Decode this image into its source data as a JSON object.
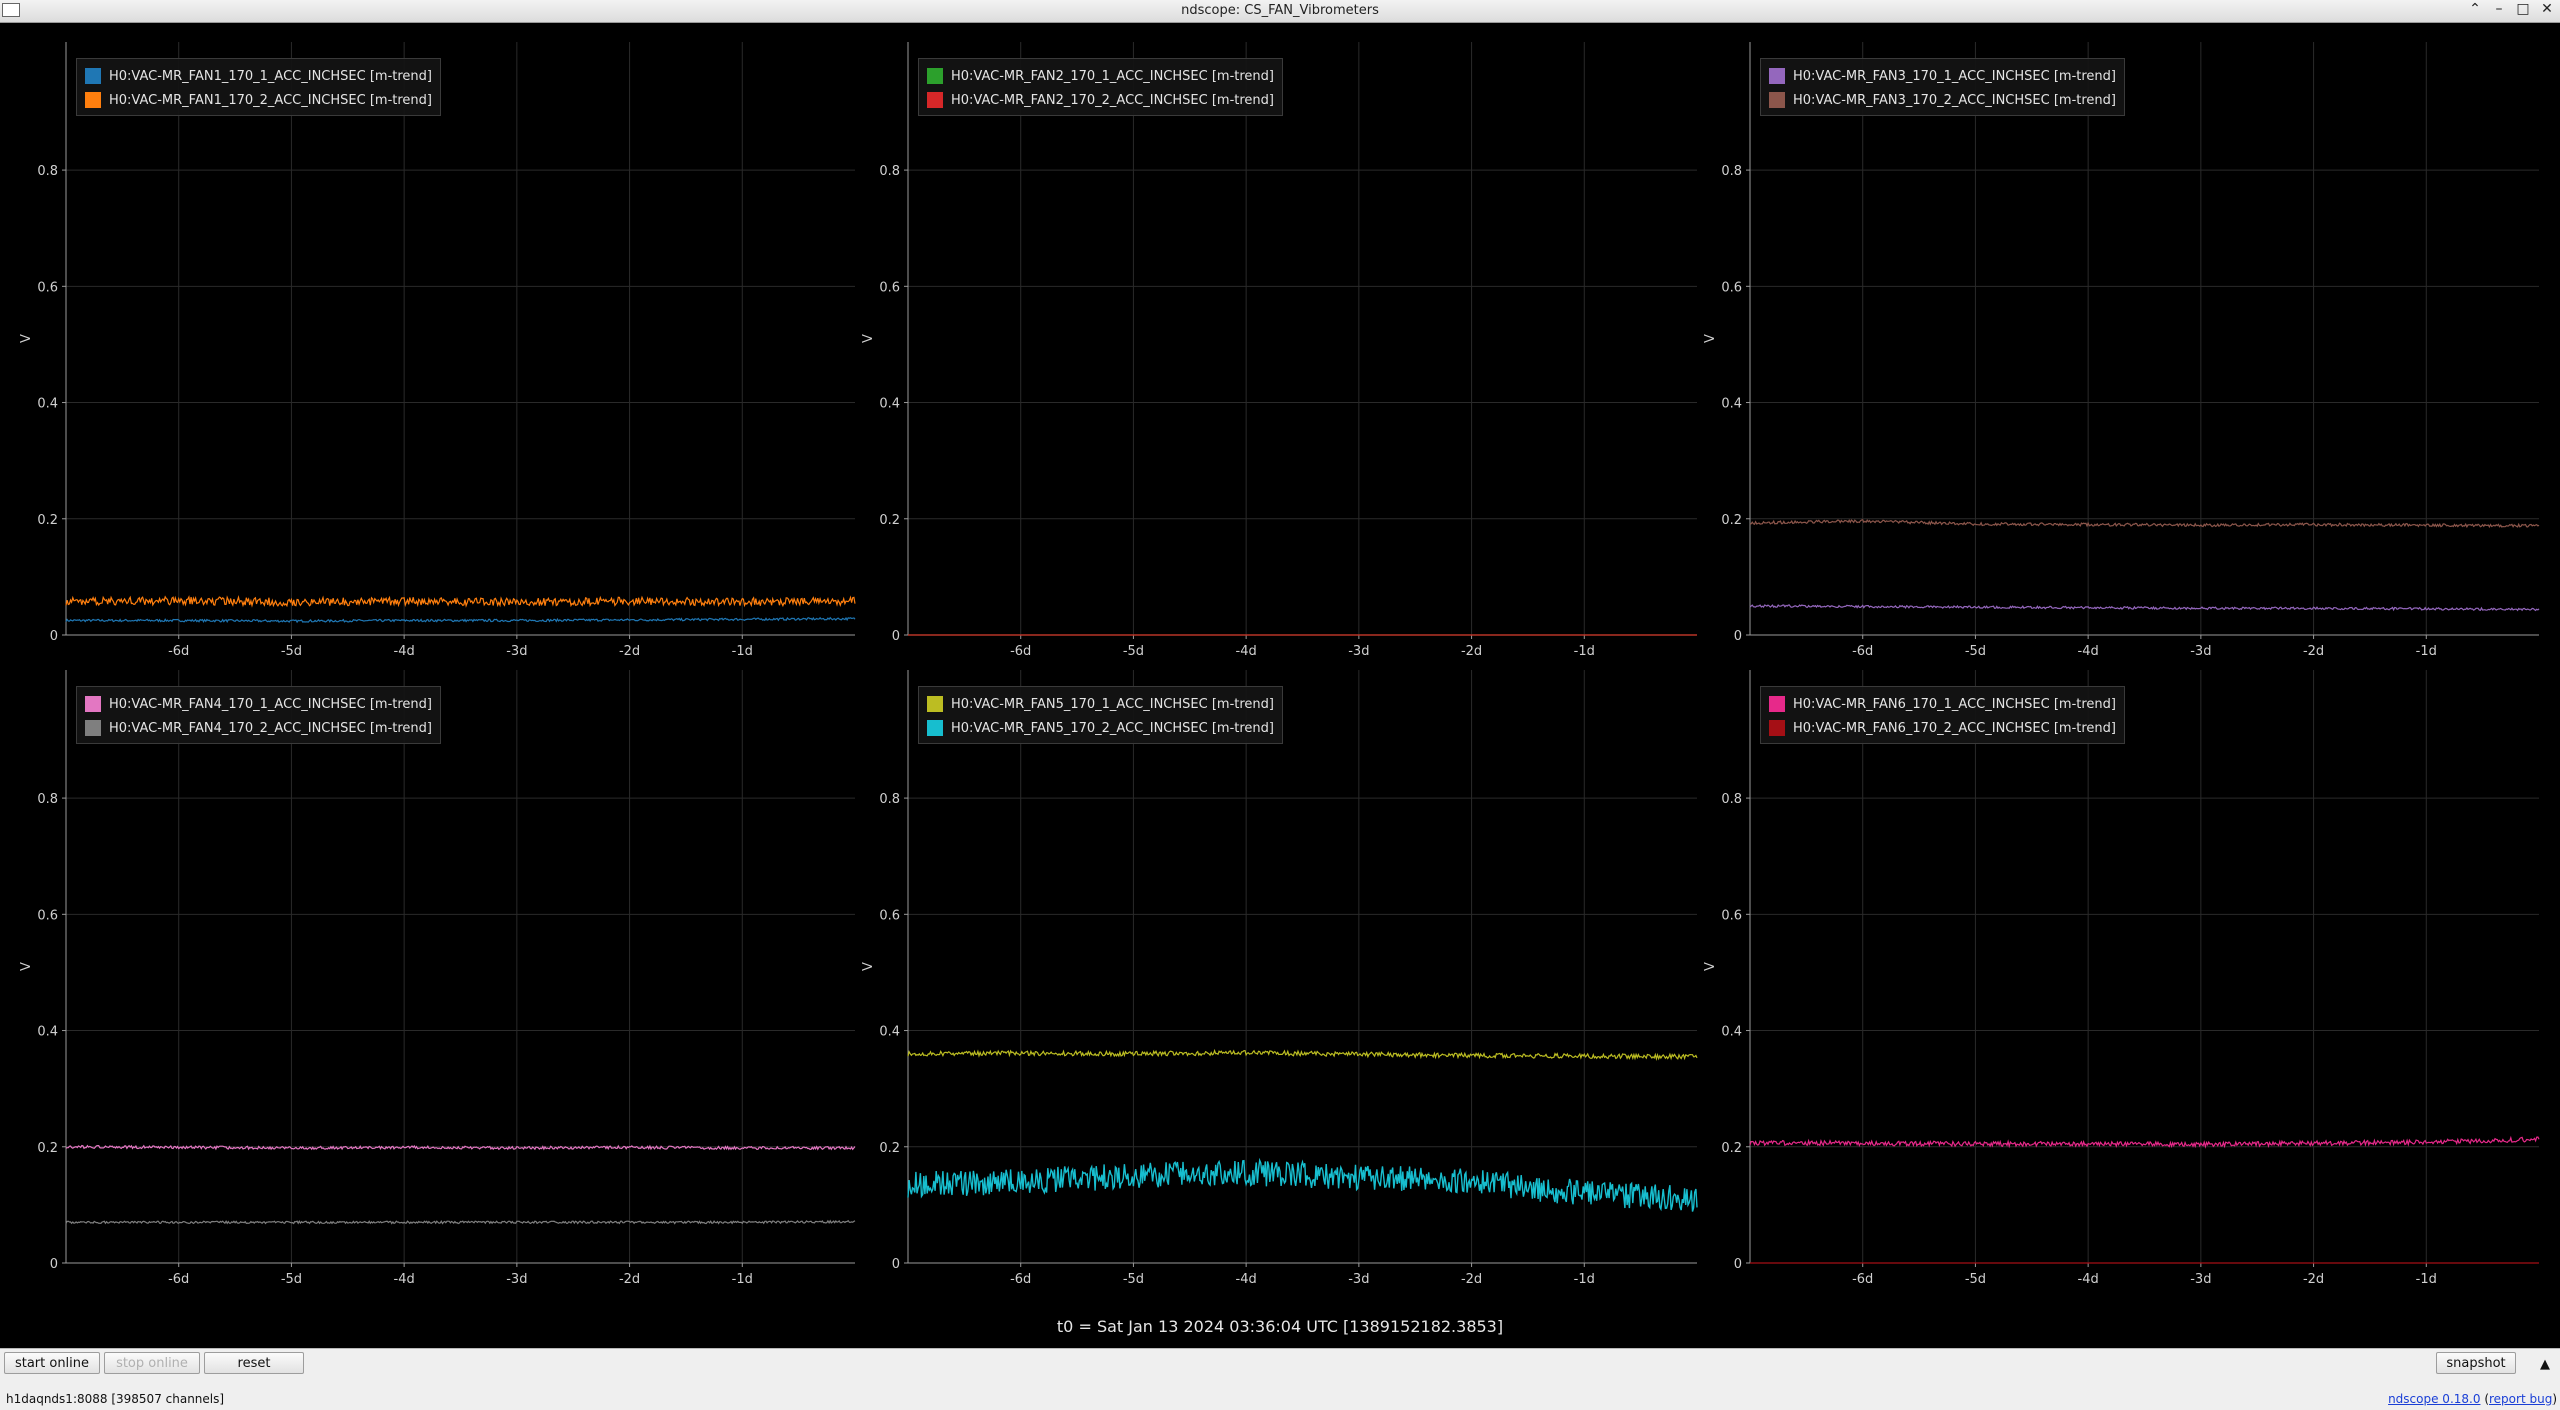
{
  "window": {
    "title": "ndscope: CS_FAN_Vibrometers",
    "controls": [
      "⌃",
      "–",
      "□",
      "✕"
    ]
  },
  "colors": {
    "grid": "#2a2a2a",
    "axis": "#9a9a9a",
    "tick_text": "#d0d0d0"
  },
  "chart_data": [
    {
      "type": "line",
      "ylabel": "V",
      "ylim": [
        0,
        1
      ],
      "yticks": [
        "0",
        "0.2",
        "0.4",
        "0.6",
        "0.8"
      ],
      "xlim_days": [
        -7,
        0
      ],
      "xticks": [
        "-6d",
        "-5d",
        "-4d",
        "-3d",
        "-2d",
        "-1d"
      ],
      "series": [
        {
          "name": "H0:VAC-MR_FAN1_170_1_ACC_INCHSEC [m-trend]",
          "color": "#1f77b4",
          "values": [
            0.025,
            0.025,
            0.024,
            0.025,
            0.025,
            0.026,
            0.027,
            0.028
          ],
          "spread": 0.004
        },
        {
          "name": "H0:VAC-MR_FAN1_170_2_ACC_INCHSEC [m-trend]",
          "color": "#ff7f0e",
          "values": [
            0.058,
            0.059,
            0.057,
            0.058,
            0.057,
            0.058,
            0.057,
            0.058
          ],
          "spread": 0.014
        }
      ]
    },
    {
      "type": "line",
      "ylabel": "V",
      "ylim": [
        0,
        1
      ],
      "yticks": [
        "0",
        "0.2",
        "0.4",
        "0.6",
        "0.8"
      ],
      "xlim_days": [
        -7,
        0
      ],
      "xticks": [
        "-6d",
        "-5d",
        "-4d",
        "-3d",
        "-2d",
        "-1d"
      ],
      "series": [
        {
          "name": "H0:VAC-MR_FAN2_170_1_ACC_INCHSEC [m-trend]",
          "color": "#2ca02c",
          "values": [
            0,
            0,
            0,
            0,
            0,
            0,
            0,
            0
          ],
          "spread": 0
        },
        {
          "name": "H0:VAC-MR_FAN2_170_2_ACC_INCHSEC [m-trend]",
          "color": "#d62728",
          "values": [
            0,
            0,
            0,
            0,
            0,
            0,
            0,
            0
          ],
          "spread": 0
        }
      ]
    },
    {
      "type": "line",
      "ylabel": "V",
      "ylim": [
        0,
        1
      ],
      "yticks": [
        "0",
        "0.2",
        "0.4",
        "0.6",
        "0.8"
      ],
      "xlim_days": [
        -7,
        0
      ],
      "xticks": [
        "-6d",
        "-5d",
        "-4d",
        "-3d",
        "-2d",
        "-1d"
      ],
      "series": [
        {
          "name": "H0:VAC-MR_FAN3_170_1_ACC_INCHSEC [m-trend]",
          "color": "#9467bd",
          "values": [
            0.05,
            0.049,
            0.048,
            0.047,
            0.046,
            0.046,
            0.045,
            0.044
          ],
          "spread": 0.004
        },
        {
          "name": "H0:VAC-MR_FAN3_170_2_ACC_INCHSEC [m-trend]",
          "color": "#8c564b",
          "values": [
            0.193,
            0.196,
            0.191,
            0.19,
            0.189,
            0.19,
            0.189,
            0.188
          ],
          "spread": 0.005
        }
      ]
    },
    {
      "type": "line",
      "ylabel": "V",
      "ylim": [
        0,
        1
      ],
      "yticks": [
        "0",
        "0.2",
        "0.4",
        "0.6",
        "0.8"
      ],
      "xlim_days": [
        -7,
        0
      ],
      "xticks": [
        "-6d",
        "-5d",
        "-4d",
        "-3d",
        "-2d",
        "-1d"
      ],
      "series": [
        {
          "name": "H0:VAC-MR_FAN4_170_1_ACC_INCHSEC [m-trend]",
          "color": "#e377c2",
          "values": [
            0.2,
            0.199,
            0.198,
            0.199,
            0.198,
            0.199,
            0.198,
            0.198
          ],
          "spread": 0.005
        },
        {
          "name": "H0:VAC-MR_FAN4_170_2_ACC_INCHSEC [m-trend]",
          "color": "#7f7f7f",
          "values": [
            0.07,
            0.07,
            0.07,
            0.07,
            0.07,
            0.07,
            0.07,
            0.071
          ],
          "spread": 0.004
        }
      ]
    },
    {
      "type": "line",
      "ylabel": "V",
      "ylim": [
        0,
        1
      ],
      "yticks": [
        "0",
        "0.2",
        "0.4",
        "0.6",
        "0.8"
      ],
      "xlim_days": [
        -7,
        0
      ],
      "xticks": [
        "-6d",
        "-5d",
        "-4d",
        "-3d",
        "-2d",
        "-1d"
      ],
      "series": [
        {
          "name": "H0:VAC-MR_FAN5_170_1_ACC_INCHSEC [m-trend]",
          "color": "#bcbd22",
          "values": [
            0.36,
            0.361,
            0.36,
            0.362,
            0.359,
            0.357,
            0.356,
            0.355
          ],
          "spread": 0.008
        },
        {
          "name": "H0:VAC-MR_FAN5_170_2_ACC_INCHSEC [m-trend]",
          "color": "#17becf",
          "values": [
            0.135,
            0.14,
            0.15,
            0.155,
            0.148,
            0.14,
            0.12,
            0.11
          ],
          "spread": 0.045
        }
      ]
    },
    {
      "type": "line",
      "ylabel": "V",
      "ylim": [
        0,
        1
      ],
      "yticks": [
        "0",
        "0.2",
        "0.4",
        "0.6",
        "0.8"
      ],
      "xlim_days": [
        -7,
        0
      ],
      "xticks": [
        "-6d",
        "-5d",
        "-4d",
        "-3d",
        "-2d",
        "-1d"
      ],
      "series": [
        {
          "name": "H0:VAC-MR_FAN6_170_1_ACC_INCHSEC [m-trend]",
          "color": "#e7298a",
          "values": [
            0.207,
            0.206,
            0.205,
            0.205,
            0.204,
            0.206,
            0.208,
            0.213
          ],
          "spread": 0.008
        },
        {
          "name": "H0:VAC-MR_FAN6_170_2_ACC_INCHSEC [m-trend]",
          "color": "#a50f15",
          "values": [
            0,
            0,
            0,
            0,
            0,
            0,
            0,
            0
          ],
          "spread": 0
        }
      ]
    }
  ],
  "t0": "t0 = Sat Jan 13 2024 03:36:04 UTC [1389152182.3853]",
  "toolbar": {
    "start_online": "start online",
    "stop_online": "stop online",
    "reset": "reset",
    "snapshot": "snapshot",
    "expand_arrow": "▲"
  },
  "status": {
    "server": "h1daqnds1:8088  [398507 channels]",
    "version": "ndscope 0.18.0",
    "report_bug": "report bug"
  }
}
